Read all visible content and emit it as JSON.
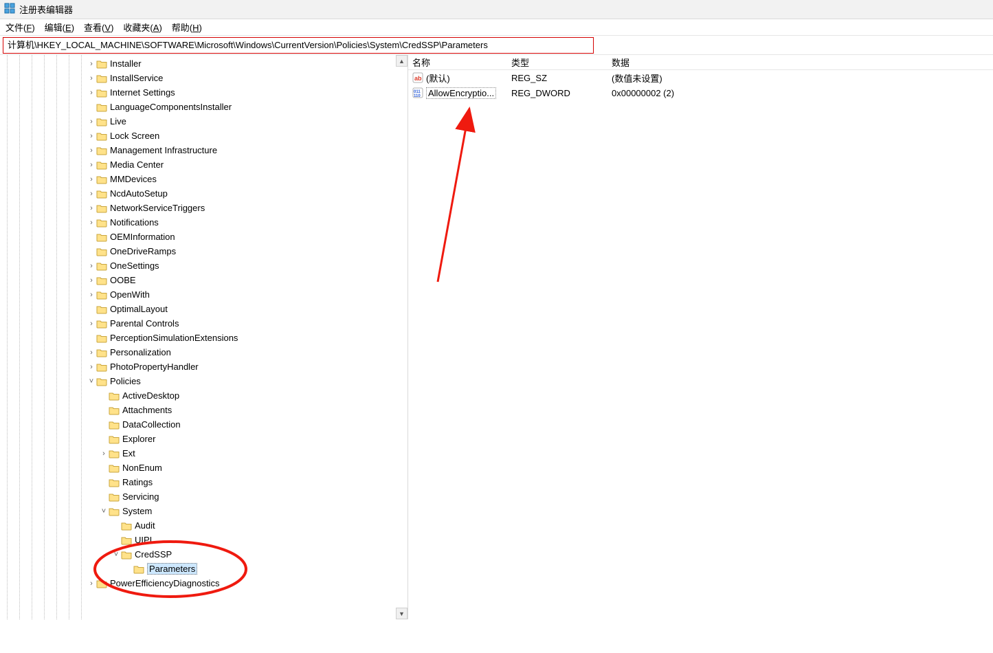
{
  "window": {
    "title": "注册表编辑器"
  },
  "menu": {
    "file": {
      "label": "文件",
      "accel": "F"
    },
    "edit": {
      "label": "编辑",
      "accel": "E"
    },
    "view": {
      "label": "查看",
      "accel": "V"
    },
    "fav": {
      "label": "收藏夹",
      "accel": "A"
    },
    "help": {
      "label": "帮助",
      "accel": "H"
    }
  },
  "address": "计算机\\HKEY_LOCAL_MACHINE\\SOFTWARE\\Microsoft\\Windows\\CurrentVersion\\Policies\\System\\CredSSP\\Parameters",
  "tree": {
    "indent_base": 7,
    "items": [
      {
        "depth": 7,
        "exp": ">",
        "label": "Installer"
      },
      {
        "depth": 7,
        "exp": ">",
        "label": "InstallService"
      },
      {
        "depth": 7,
        "exp": ">",
        "label": "Internet Settings"
      },
      {
        "depth": 7,
        "exp": "",
        "label": "LanguageComponentsInstaller"
      },
      {
        "depth": 7,
        "exp": ">",
        "label": "Live"
      },
      {
        "depth": 7,
        "exp": ">",
        "label": "Lock Screen"
      },
      {
        "depth": 7,
        "exp": ">",
        "label": "Management Infrastructure"
      },
      {
        "depth": 7,
        "exp": ">",
        "label": "Media Center"
      },
      {
        "depth": 7,
        "exp": ">",
        "label": "MMDevices"
      },
      {
        "depth": 7,
        "exp": ">",
        "label": "NcdAutoSetup"
      },
      {
        "depth": 7,
        "exp": ">",
        "label": "NetworkServiceTriggers"
      },
      {
        "depth": 7,
        "exp": ">",
        "label": "Notifications"
      },
      {
        "depth": 7,
        "exp": "",
        "label": "OEMInformation"
      },
      {
        "depth": 7,
        "exp": "",
        "label": "OneDriveRamps"
      },
      {
        "depth": 7,
        "exp": ">",
        "label": "OneSettings"
      },
      {
        "depth": 7,
        "exp": ">",
        "label": "OOBE"
      },
      {
        "depth": 7,
        "exp": ">",
        "label": "OpenWith"
      },
      {
        "depth": 7,
        "exp": "",
        "label": "OptimalLayout"
      },
      {
        "depth": 7,
        "exp": ">",
        "label": "Parental Controls"
      },
      {
        "depth": 7,
        "exp": "",
        "label": "PerceptionSimulationExtensions"
      },
      {
        "depth": 7,
        "exp": ">",
        "label": "Personalization"
      },
      {
        "depth": 7,
        "exp": ">",
        "label": "PhotoPropertyHandler"
      },
      {
        "depth": 7,
        "exp": "v",
        "label": "Policies"
      },
      {
        "depth": 8,
        "exp": "",
        "label": "ActiveDesktop"
      },
      {
        "depth": 8,
        "exp": "",
        "label": "Attachments"
      },
      {
        "depth": 8,
        "exp": "",
        "label": "DataCollection"
      },
      {
        "depth": 8,
        "exp": "",
        "label": "Explorer"
      },
      {
        "depth": 8,
        "exp": ">",
        "label": "Ext"
      },
      {
        "depth": 8,
        "exp": "",
        "label": "NonEnum"
      },
      {
        "depth": 8,
        "exp": "",
        "label": "Ratings"
      },
      {
        "depth": 8,
        "exp": "",
        "label": "Servicing"
      },
      {
        "depth": 8,
        "exp": "v",
        "label": "System"
      },
      {
        "depth": 9,
        "exp": "",
        "label": "Audit"
      },
      {
        "depth": 9,
        "exp": "",
        "label": "UIPI"
      },
      {
        "depth": 9,
        "exp": "v",
        "label": "CredSSP"
      },
      {
        "depth": 10,
        "exp": "",
        "label": "Parameters",
        "selected": true
      },
      {
        "depth": 7,
        "exp": ">",
        "label": "PowerEfficiencyDiagnostics"
      }
    ]
  },
  "values": {
    "headers": {
      "name": "名称",
      "type": "类型",
      "data": "数据"
    },
    "rows": [
      {
        "icon": "sz",
        "name": "(默认)",
        "type": "REG_SZ",
        "data": "(数值未设置)"
      },
      {
        "icon": "bin",
        "name": "AllowEncryptio...",
        "type": "REG_DWORD",
        "data": "0x00000002 (2)",
        "boxed": true
      }
    ]
  }
}
